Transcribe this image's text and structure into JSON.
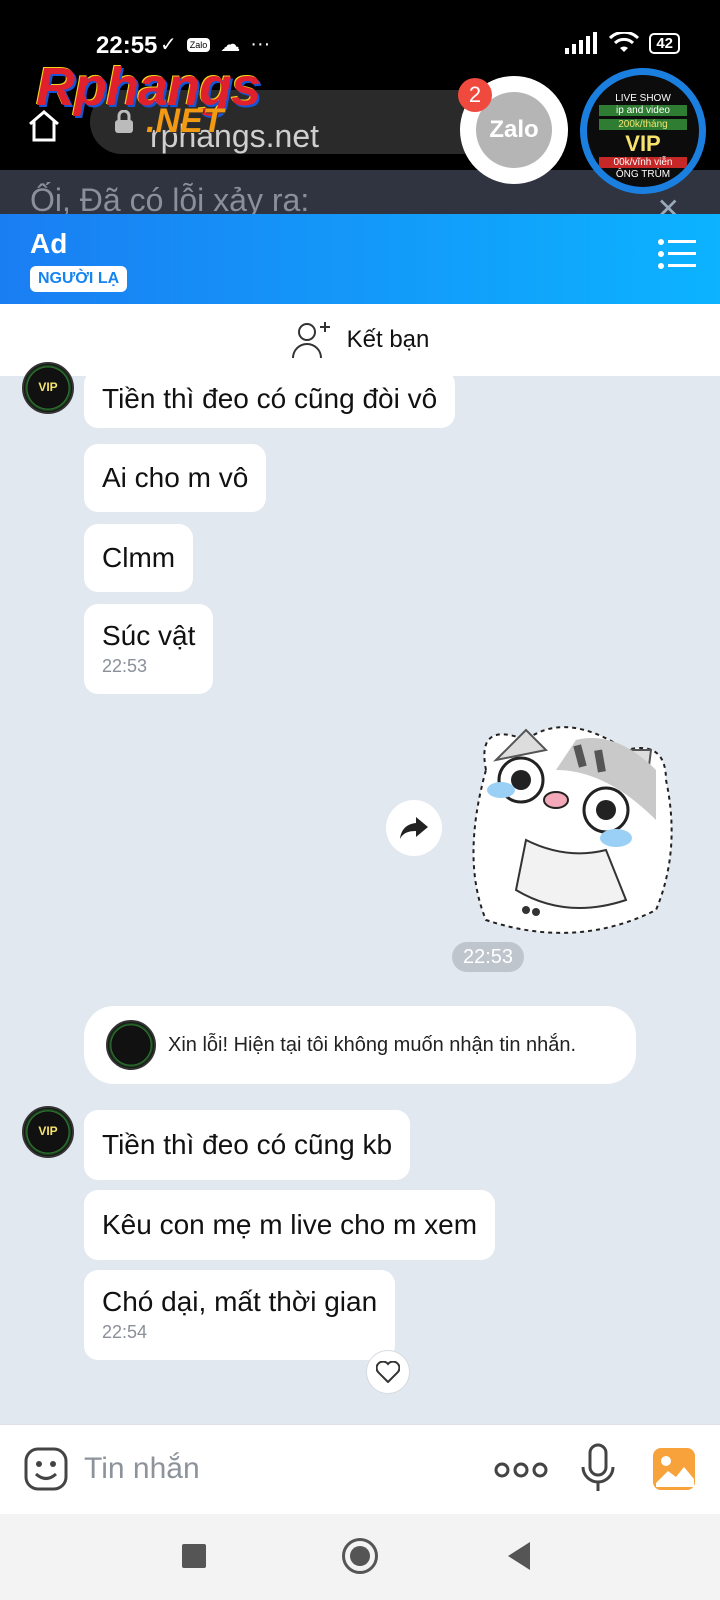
{
  "status_bar": {
    "time": "22:55",
    "zalo_label": "Zalo",
    "battery": "42"
  },
  "browser": {
    "url": "rphangs.net"
  },
  "watermark": {
    "brand": "Rphangs",
    "suffix": ".NET"
  },
  "floating": {
    "zalo_label": "Zalo",
    "zalo_badge": "2",
    "vip": {
      "line1": "LIVE SHOW",
      "line2": "ip and video",
      "line3": "200k/tháng",
      "line4": "VIP",
      "line5": "00k/vĩnh viễn",
      "line6": "ÔNG TRÙM"
    }
  },
  "error_text": "Ối, Đã có lỗi xảy ra:",
  "header": {
    "title": "Ad",
    "badge": "NGƯỜI LẠ"
  },
  "friend_bar": {
    "label": "Kết bạn"
  },
  "messages_top": [
    {
      "text": "Tiền thì đeo có cũng đòi vô"
    },
    {
      "text": "Ai cho m vô"
    },
    {
      "text": "Clmm"
    },
    {
      "text": "Súc vật",
      "time": "22:53"
    }
  ],
  "sticker": {
    "time": "22:53"
  },
  "system_message": "Xin lỗi! Hiện tại tôi không muốn nhận tin nhắn.",
  "messages_bottom": [
    {
      "text": "Tiền thì đeo có cũng kb"
    },
    {
      "text": "Kêu con mẹ m live cho m xem"
    },
    {
      "text": "Chó dại, mất thời gian",
      "time": "22:54"
    }
  ],
  "composer": {
    "placeholder": "Tin nhắn"
  },
  "colors": {
    "header_start": "#1a7ef3",
    "header_end": "#0cb3ff",
    "chat_background": "#e2e8f0",
    "photo_button": "#f7a23b"
  }
}
